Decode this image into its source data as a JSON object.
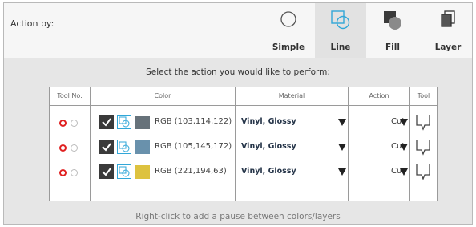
{
  "panel": {
    "action_by_label": "Action by:",
    "modes": [
      {
        "label": "Simple",
        "icon": "circle-outline-icon"
      },
      {
        "label": "Line",
        "icon": "line-shapes-icon",
        "active": true
      },
      {
        "label": "Fill",
        "icon": "fill-shapes-icon"
      },
      {
        "label": "Layer",
        "icon": "layer-squares-icon"
      }
    ],
    "prompt": "Select the action you would like to perform:",
    "hint": "Right-click to add a pause between colors/layers"
  },
  "table": {
    "headers": {
      "tool_no": "Tool No.",
      "color": "Color",
      "material": "Material",
      "action": "Action",
      "tool": "Tool"
    },
    "rows": [
      {
        "rgb": "RGB (103,114,122)",
        "swatch": "#67727a",
        "material": "Vinyl, Glossy",
        "action": "Cut"
      },
      {
        "rgb": "RGB (105,145,172)",
        "swatch": "#6991ac",
        "material": "Vinyl, Glossy",
        "action": "Cut"
      },
      {
        "rgb": "RGB (221,194,63)",
        "swatch": "#ddc23f",
        "material": "Vinyl, Glossy",
        "action": "Cut"
      }
    ]
  },
  "colors": {
    "accent_blue": "#31a7d8",
    "tool_red": "#e02020",
    "checkbox_dark": "#3a3a3a"
  }
}
